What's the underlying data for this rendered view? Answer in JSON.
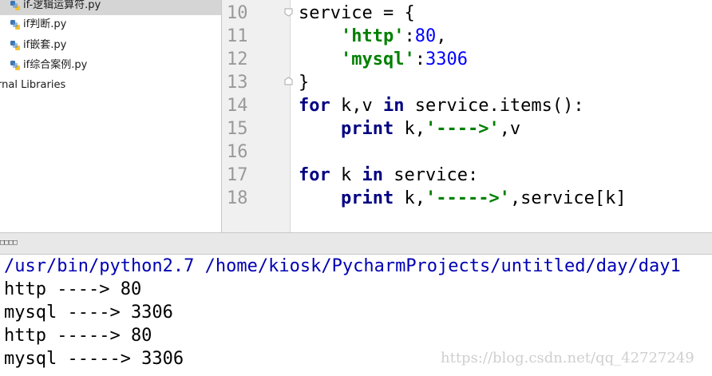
{
  "project_tree": {
    "files": [
      {
        "name": "if-逻辑运算符.py",
        "selected": true,
        "icon": "python-file-icon"
      },
      {
        "name": "if判断.py",
        "selected": false,
        "icon": "python-file-icon"
      },
      {
        "name": "if嵌套.py",
        "selected": false,
        "icon": "python-file-icon"
      },
      {
        "name": "if综合案例.py",
        "selected": false,
        "icon": "python-file-icon"
      }
    ],
    "external_libraries_label": "rnal Libraries"
  },
  "editor": {
    "line_numbers": [
      "10",
      "11",
      "12",
      "13",
      "14",
      "15",
      "16",
      "17",
      "18"
    ],
    "code": {
      "l10": {
        "text": "service = {"
      },
      "l11": {
        "indent": "    ",
        "key": "'http'",
        "colon": ":",
        "value": "80",
        "tail": ","
      },
      "l12": {
        "indent": "    ",
        "key": "'mysql'",
        "colon": ":",
        "value": "3306"
      },
      "l13": {
        "text": "}"
      },
      "l14": {
        "kw1": "for",
        "mid": " k,v ",
        "kw2": "in",
        "rest": " service.items():"
      },
      "l15": {
        "indent": "    ",
        "kw": "print",
        "mid": " k,",
        "str": "'---->'",
        "rest": ",v"
      },
      "l17": {
        "kw1": "for",
        "mid": " k ",
        "kw2": "in",
        "rest": " service:"
      },
      "l18": {
        "indent": "    ",
        "kw": "print",
        "mid": " k,",
        "str": "'----->'",
        "rest": ",service[k]"
      }
    },
    "colors": {
      "keyword": "#000080",
      "string": "#008000",
      "number": "#0000ff",
      "gutter_bg": "#f0f0f0"
    }
  },
  "run_panel": {
    "header_label": "□□□□",
    "command": "/usr/bin/python2.7 /home/kiosk/PycharmProjects/untitled/day/day1",
    "output": [
      "http ----> 80",
      "mysql ----> 3306",
      "http -----> 80",
      "mysql -----> 3306"
    ]
  },
  "watermark": "https://blog.csdn.net/qq_42727249"
}
